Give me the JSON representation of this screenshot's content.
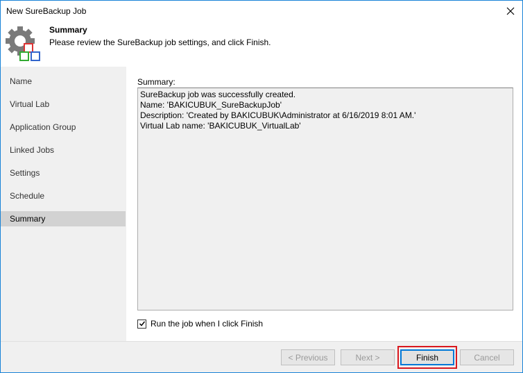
{
  "window": {
    "title": "New SureBackup Job"
  },
  "header": {
    "title": "Summary",
    "subtitle": "Please review the SureBackup job settings, and click Finish."
  },
  "sidebar": {
    "items": [
      {
        "label": "Name"
      },
      {
        "label": "Virtual Lab"
      },
      {
        "label": "Application Group"
      },
      {
        "label": "Linked Jobs"
      },
      {
        "label": "Settings"
      },
      {
        "label": "Schedule"
      },
      {
        "label": "Summary",
        "active": true
      }
    ]
  },
  "main": {
    "summary_label": "Summary:",
    "summary_lines": [
      "SureBackup job was successfully created.",
      "Name: 'BAKICUBUK_SureBackupJob'",
      "Description: 'Created by BAKICUBUK\\Administrator at 6/16/2019 8:01 AM.'",
      "Virtual Lab name: 'BAKICUBUK_VirtualLab'"
    ],
    "run_checkbox_label": "Run the job when I click Finish",
    "run_checkbox_checked": true
  },
  "footer": {
    "previous_label": "< Previous",
    "next_label": "Next >",
    "finish_label": "Finish",
    "cancel_label": "Cancel"
  },
  "colors": {
    "accent": "#0078d7",
    "highlight_border": "#d9181f",
    "sidebar_active": "#d2d2d2"
  }
}
